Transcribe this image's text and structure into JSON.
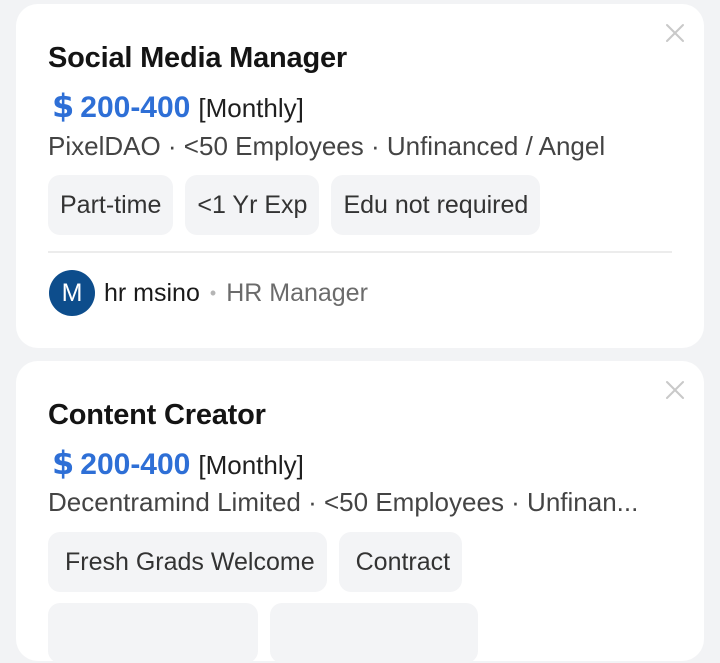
{
  "jobs": [
    {
      "title": "Social Media Manager",
      "salary_symbol": "$",
      "salary_range": "200-400",
      "salary_period": "[Monthly]",
      "company_line": "PixelDAO · <50 Employees · Unfinanced / Angel",
      "tags": [
        "Part-time",
        "<1 Yr Exp",
        "Edu not required"
      ],
      "recruiter": {
        "avatar_letter": "M",
        "name": "hr msino",
        "separator": "•",
        "role": "HR Manager"
      }
    },
    {
      "title": "Content Creator",
      "salary_symbol": "$",
      "salary_range": "200-400",
      "salary_period": "[Monthly]",
      "company_line": "Decentramind Limited · <50 Employees · Unfinan...",
      "tags": [
        "Fresh Grads Welcome",
        "Contract"
      ]
    }
  ],
  "icons": {
    "close": "close-icon"
  },
  "colors": {
    "accent": "#2e6fd6",
    "avatar_bg": "#0d4d8c",
    "tag_bg": "#f3f4f6",
    "card_bg": "#ffffff",
    "page_bg": "#f2f3f5"
  }
}
